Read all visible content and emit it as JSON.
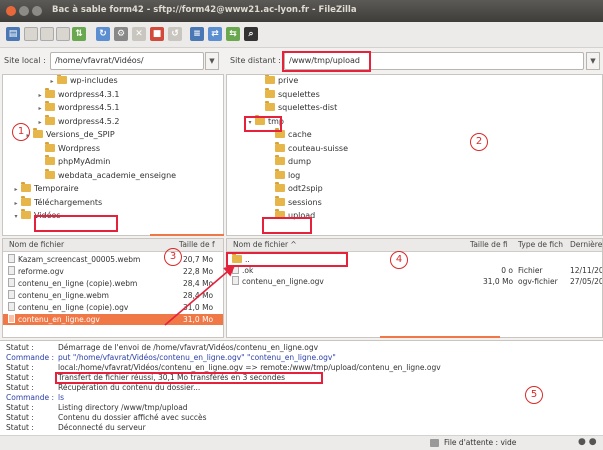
{
  "window": {
    "title": "Bac à sable form42 - sftp://form42@www21.ac-lyon.fr - FileZilla"
  },
  "local": {
    "label": "Site local :",
    "path": "/home/vfavrat/Vidéos/",
    "tree": [
      {
        "label": "wp-includes",
        "depth": 3,
        "expander": "▸"
      },
      {
        "label": "wordpress4.3.1",
        "depth": 2,
        "expander": "▸"
      },
      {
        "label": "wordpress4.5.1",
        "depth": 2,
        "expander": "▸"
      },
      {
        "label": "wordpress4.5.2",
        "depth": 2,
        "expander": "▸"
      },
      {
        "label": "Versions_de_SPIP",
        "depth": 1,
        "expander": "▸"
      },
      {
        "label": "Wordpress",
        "depth": 2,
        "expander": ""
      },
      {
        "label": "phpMyAdmin",
        "depth": 2,
        "expander": ""
      },
      {
        "label": "webdata_academie_enseigne",
        "depth": 2,
        "expander": ""
      },
      {
        "label": "Temporaire",
        "depth": 0,
        "expander": "▸"
      },
      {
        "label": "Téléchargements",
        "depth": 0,
        "expander": "▸"
      },
      {
        "label": "Vidéos",
        "depth": 0,
        "expander": "▾"
      }
    ],
    "list_headers": {
      "name": "Nom de fichier",
      "size": "Taille de f"
    },
    "files": [
      {
        "name": "Kazam_screencast_00005.webm",
        "size": "20,7 Mo"
      },
      {
        "name": "reforme.ogv",
        "size": "22,8 Mo"
      },
      {
        "name": "contenu_en_ligne (copie).webm",
        "size": "28,4 Mo"
      },
      {
        "name": "contenu_en_ligne.webm",
        "size": "28,4 Mo"
      },
      {
        "name": "contenu_en_ligne (copie).ogv",
        "size": "31,0 Mo"
      },
      {
        "name": "contenu_en_ligne.ogv",
        "size": "31,0 Mo"
      }
    ]
  },
  "remote": {
    "label": "Site distant :",
    "path": "/www/tmp/upload",
    "tree": [
      {
        "label": "prive",
        "depth": 1,
        "expander": ""
      },
      {
        "label": "squelettes",
        "depth": 1,
        "expander": ""
      },
      {
        "label": "squelettes-dist",
        "depth": 1,
        "expander": ""
      },
      {
        "label": "tmp",
        "depth": 0,
        "expander": "▾"
      },
      {
        "label": "cache",
        "depth": 2,
        "expander": ""
      },
      {
        "label": "couteau-suisse",
        "depth": 2,
        "expander": ""
      },
      {
        "label": "dump",
        "depth": 2,
        "expander": ""
      },
      {
        "label": "log",
        "depth": 2,
        "expander": ""
      },
      {
        "label": "odt2spip",
        "depth": 2,
        "expander": ""
      },
      {
        "label": "sessions",
        "depth": 2,
        "expander": ""
      },
      {
        "label": "upload",
        "depth": 2,
        "expander": ""
      }
    ],
    "list_headers": {
      "name": "Nom de fichier ^",
      "size": "Taille de fi",
      "type": "Type de fich",
      "date": "Dernière"
    },
    "files": [
      {
        "name": "..",
        "size": "",
        "type": "",
        "date": ""
      },
      {
        "name": ".ok",
        "size": "0 o",
        "type": "Fichier",
        "date": "12/11/20"
      },
      {
        "name": "contenu_en_ligne.ogv",
        "size": "31,0 Mo",
        "type": "ogv-fichier",
        "date": "27/05/20"
      }
    ]
  },
  "log": [
    {
      "kind": "status",
      "label": "Statut :",
      "text": "Démarrage de l'envoi de /home/vfavrat/Vidéos/contenu_en_ligne.ogv"
    },
    {
      "kind": "cmd",
      "label": "Commande :",
      "text": "put \"/home/vfavrat/Vidéos/contenu_en_ligne.ogv\" \"contenu_en_ligne.ogv\""
    },
    {
      "kind": "status",
      "label": "Statut :",
      "text": "local:/home/vfavrat/Vidéos/contenu_en_ligne.ogv => remote:/www/tmp/upload/contenu_en_ligne.ogv"
    },
    {
      "kind": "status",
      "label": "Statut :",
      "text": "Transfert de fichier réussi, 30,1 Mo transférés en 3 secondes"
    },
    {
      "kind": "status",
      "label": "Statut :",
      "text": "Récupération du contenu du dossier..."
    },
    {
      "kind": "cmd",
      "label": "Commande :",
      "text": "ls"
    },
    {
      "kind": "status",
      "label": "Statut :",
      "text": "Listing directory /www/tmp/upload"
    },
    {
      "kind": "status",
      "label": "Statut :",
      "text": "Contenu du dossier affiché avec succès"
    },
    {
      "kind": "status",
      "label": "Statut :",
      "text": "Déconnecté du serveur"
    }
  ],
  "statusbar": {
    "queue": "File d'attente : vide"
  },
  "annotations": [
    "1",
    "2",
    "3",
    "4",
    "5"
  ],
  "colors": {
    "accent": "#f07746",
    "annotation": "#e5213c",
    "command": "#2b3fa8"
  }
}
